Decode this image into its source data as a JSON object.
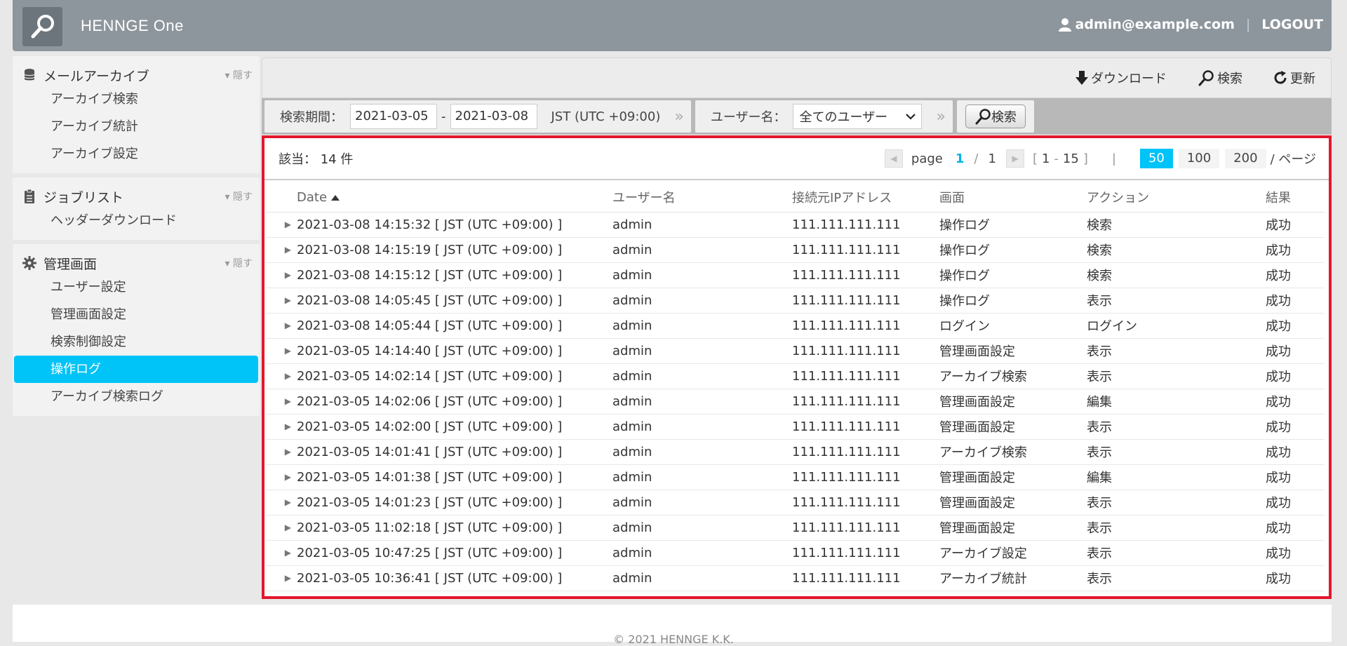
{
  "header": {
    "brand": "HENNGE One",
    "user_email": "admin@example.com",
    "separator": "|",
    "logout_label": "LOGOUT"
  },
  "sidebar": {
    "hide_label": "▾ 隠す",
    "sections": [
      {
        "title": "メールアーカイブ",
        "items": [
          "アーカイブ検索",
          "アーカイブ統計",
          "アーカイブ設定"
        ]
      },
      {
        "title": "ジョブリスト",
        "items": [
          "ヘッダーダウンロード"
        ]
      },
      {
        "title": "管理画面",
        "items": [
          "ユーザー設定",
          "管理画面設定",
          "検索制御設定",
          "操作ログ",
          "アーカイブ検索ログ"
        ]
      }
    ],
    "active_item": "操作ログ"
  },
  "toolbar": {
    "download_label": "ダウンロード",
    "search_label": "検索",
    "refresh_label": "更新"
  },
  "filter": {
    "period_label": "検索期間：",
    "date_from": "2021-03-05",
    "date_sep": "-",
    "date_to": "2021-03-08",
    "timezone": "JST (UTC +09:00)",
    "chevron": "»",
    "user_label": "ユーザー名：",
    "user_select": "全てのユーザー",
    "search_button": "検索"
  },
  "results": {
    "count_text": "該当： 14 件",
    "pager": {
      "page_label": "page",
      "current": "1",
      "slash": "/",
      "total": "1",
      "range_open": "[",
      "range_start": "1",
      "range_dash": "-",
      "range_end": "15",
      "range_close": "]",
      "divider": "|",
      "sizes": [
        "50",
        "100",
        "200"
      ],
      "active_size": "50",
      "per_page_label": "/ ページ"
    },
    "columns": {
      "date": "Date",
      "user": "ユーザー名",
      "ip": "接続元IPアドレス",
      "screen": "画面",
      "action": "アクション",
      "result": "結果"
    },
    "rows": [
      {
        "date": "2021-03-08 14:15:32 [ JST (UTC +09:00) ]",
        "user": "admin",
        "ip": "111.111.111.111",
        "screen": "操作ログ",
        "action": "検索",
        "result": "成功"
      },
      {
        "date": "2021-03-08 14:15:19 [ JST (UTC +09:00) ]",
        "user": "admin",
        "ip": "111.111.111.111",
        "screen": "操作ログ",
        "action": "検索",
        "result": "成功"
      },
      {
        "date": "2021-03-08 14:15:12 [ JST (UTC +09:00) ]",
        "user": "admin",
        "ip": "111.111.111.111",
        "screen": "操作ログ",
        "action": "検索",
        "result": "成功"
      },
      {
        "date": "2021-03-08 14:05:45 [ JST (UTC +09:00) ]",
        "user": "admin",
        "ip": "111.111.111.111",
        "screen": "操作ログ",
        "action": "表示",
        "result": "成功"
      },
      {
        "date": "2021-03-08 14:05:44 [ JST (UTC +09:00) ]",
        "user": "admin",
        "ip": "111.111.111.111",
        "screen": "ログイン",
        "action": "ログイン",
        "result": "成功"
      },
      {
        "date": "2021-03-05 14:14:40 [ JST (UTC +09:00) ]",
        "user": "admin",
        "ip": "111.111.111.111",
        "screen": "管理画面設定",
        "action": "表示",
        "result": "成功"
      },
      {
        "date": "2021-03-05 14:02:14 [ JST (UTC +09:00) ]",
        "user": "admin",
        "ip": "111.111.111.111",
        "screen": "アーカイブ検索",
        "action": "表示",
        "result": "成功"
      },
      {
        "date": "2021-03-05 14:02:06 [ JST (UTC +09:00) ]",
        "user": "admin",
        "ip": "111.111.111.111",
        "screen": "管理画面設定",
        "action": "編集",
        "result": "成功"
      },
      {
        "date": "2021-03-05 14:02:00 [ JST (UTC +09:00) ]",
        "user": "admin",
        "ip": "111.111.111.111",
        "screen": "管理画面設定",
        "action": "表示",
        "result": "成功"
      },
      {
        "date": "2021-03-05 14:01:41 [ JST (UTC +09:00) ]",
        "user": "admin",
        "ip": "111.111.111.111",
        "screen": "アーカイブ検索",
        "action": "表示",
        "result": "成功"
      },
      {
        "date": "2021-03-05 14:01:38 [ JST (UTC +09:00) ]",
        "user": "admin",
        "ip": "111.111.111.111",
        "screen": "管理画面設定",
        "action": "編集",
        "result": "成功"
      },
      {
        "date": "2021-03-05 14:01:23 [ JST (UTC +09:00) ]",
        "user": "admin",
        "ip": "111.111.111.111",
        "screen": "管理画面設定",
        "action": "表示",
        "result": "成功"
      },
      {
        "date": "2021-03-05 11:02:18 [ JST (UTC +09:00) ]",
        "user": "admin",
        "ip": "111.111.111.111",
        "screen": "管理画面設定",
        "action": "表示",
        "result": "成功"
      },
      {
        "date": "2021-03-05 10:47:25 [ JST (UTC +09:00) ]",
        "user": "admin",
        "ip": "111.111.111.111",
        "screen": "アーカイブ設定",
        "action": "表示",
        "result": "成功"
      },
      {
        "date": "2021-03-05 10:36:41 [ JST (UTC +09:00) ]",
        "user": "admin",
        "ip": "111.111.111.111",
        "screen": "アーカイブ統計",
        "action": "表示",
        "result": "成功"
      }
    ]
  },
  "footer": {
    "copyright": "© 2021 HENNGE K.K."
  },
  "colors": {
    "header_bg": "#8e969d",
    "accent": "#00c3f8",
    "highlight_border": "#e3172d"
  },
  "icons": {
    "logo": "magnifier-icon",
    "user": "user-icon",
    "mail_archive": "database-icon",
    "job_list": "clipboard-icon",
    "admin": "gear-icon",
    "download": "download-arrow-icon",
    "search": "magnifier-icon",
    "refresh": "refresh-icon",
    "row_expand": "triangle-right-icon",
    "sort": "sort-up-icon"
  }
}
